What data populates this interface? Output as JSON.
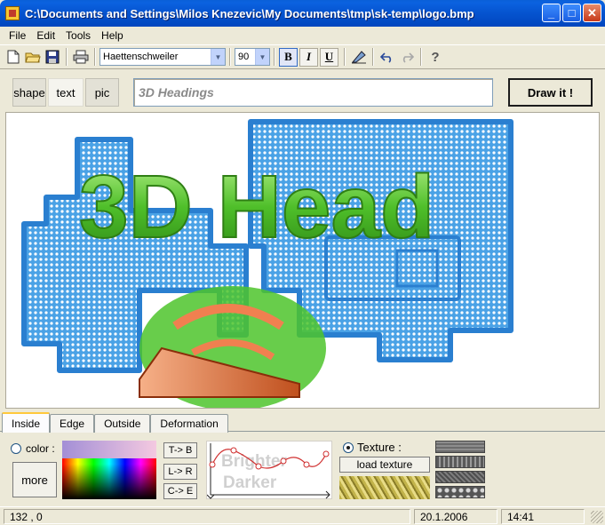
{
  "window": {
    "title": "C:\\Documents and Settings\\Milos Knezevic\\My Documents\\tmp\\sk-temp\\logo.bmp",
    "minimize": "_",
    "maximize": "□",
    "close": "✕"
  },
  "menu": [
    "File",
    "Edit",
    "Tools",
    "Help"
  ],
  "toolbar": {
    "font_name": "Haettenschweiler",
    "font_size": "90",
    "bold": "B",
    "italic": "I",
    "underline": "U",
    "icons": [
      "new-file-icon",
      "open-folder-icon",
      "save-icon",
      "print-icon",
      "clear-icon",
      "undo-icon",
      "redo-icon",
      "help-icon"
    ]
  },
  "modes": {
    "shape": "shape",
    "text": "text",
    "pic": "pic",
    "selected": "text"
  },
  "heading_input": {
    "value": "3D Headings"
  },
  "draw_button": "Draw it !",
  "canvas": {
    "headline": "3D Head",
    "colors": {
      "maze": "#3a8fd6",
      "text": "#5cc63a",
      "wedge": "#e87a4e"
    }
  },
  "tabs": [
    "Inside",
    "Edge",
    "Outside",
    "Deformation"
  ],
  "tab_selected": "Inside",
  "panel": {
    "color_label": "color :",
    "more": "more",
    "dir_tb": "T-> B",
    "dir_lr": "L-> R",
    "dir_ce": "C-> E",
    "brighter": "Brighter",
    "darker": "Darker",
    "texture_label": "Texture :",
    "load_texture": "load texture"
  },
  "status": {
    "coords": "132 ,  0",
    "date": "20.1.2006",
    "time": "14:41"
  }
}
